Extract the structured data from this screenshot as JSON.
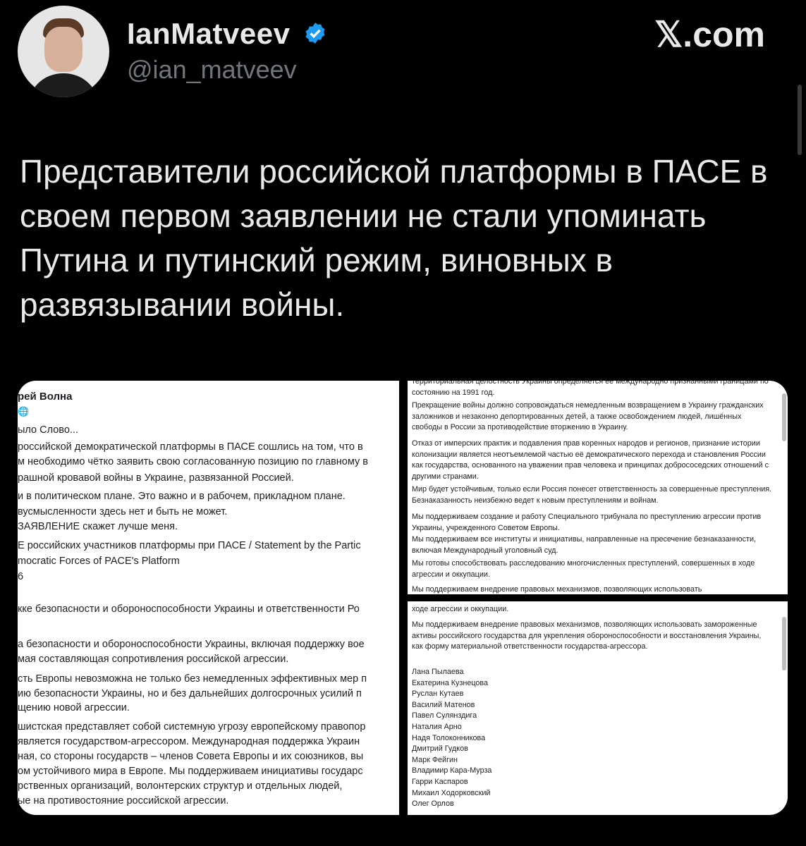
{
  "author": {
    "name": "IanMatveev",
    "handle": "@ian_matveev",
    "verified": true,
    "avatar_icon": "avatar-photo"
  },
  "brand": "𝕏.com",
  "tweet_text": "Представители российской платформы в ПАСЕ в своем первом заявлении не стали упоминать Путина и путинский режим, виновных в развязывании войны.",
  "colors": {
    "background": "#000000",
    "text": "#e7e9ea",
    "muted": "#71767b",
    "verified": "#1d9bf0"
  },
  "media": {
    "left": {
      "author": "рей Волна",
      "lines": [
        "ыло Слово...",
        "российской демократической платформы в ПАСЕ сошлись на том, что в",
        "м необходимо чётко заявить свою согласованную позицию по главному в",
        "рашной кровавой войны в Украине, развязанной Россией.",
        " и в политическом плане. Это важно и в рабочем, прикладном плане.",
        "вусмысленности здесь нет и быть не может.",
        "ЗАЯВЛЕНИЕ скажет лучше меня.",
        "Е российских участников платформы при ПАСЕ / Statement by the Partic",
        "mocratic Forces of PACE's Platform",
        "6",
        "кке безопасности и обороноспособности Украины и ответственности Ро",
        "а безопасности и обороноспособности Украины, включая поддержку вое",
        "мая составляющая сопротивления российской агрессии.",
        "сть Европы невозможна не только без немедленных эффективных мер п",
        "ию безопасности Украины, но и без дальнейших долгосрочных усилий п",
        "щению новой агрессии.",
        "шистская представляет собой системную угрозу европейскому правопор",
        "является государством-агрессором. Международная поддержка Украин",
        "ная, со стороны государств – членов Совета Европы и их союзников, вы",
        "ом устойчивого мира в Европе. Мы поддерживаем инициативы государс",
        "рственных организаций, волонтерских структур и отдельных людей,",
        "ые на противостояние российской агрессии."
      ]
    },
    "right_top": {
      "paras": [
        "территориальная целостность Украины определяется ее международно признанными границами по состоянию на 1991 год.",
        "Прекращение войны должно сопровождаться немедленным возвращением в Украину гражданских заложников и незаконно депортированных детей, а также освобождением людей, лишённых свободы в России за противодействие вторжению в Украину.",
        "Отказ от имперских практик и подавления прав коренных народов и регионов, признание истории колонизации является неотъемлемой частью её демократического перехода и становления России как государства, основанного на уважении прав человека и принципах добрососедских отношений с другими странами.",
        "Мир будет устойчивым, только если Россия понесет ответственность за совершенные преступления. Безнаказанность неизбежно ведет к новым преступлениям и войнам.",
        "Мы поддерживаем создание и работу Специального трибунала по преступлению агрессии против Украины, учрежденного Советом Европы.",
        "Мы поддерживаем все институты и инициативы, направленные на пресечение безнаказанности, включая Международный уголовный суд.",
        "Мы готовы способствовать расследованию многочисленных преступлений, совершенных в ходе агрессии и оккупации.",
        "Мы поддерживаем внедрение правовых механизмов, позволяющих использовать"
      ]
    },
    "right_bottom": {
      "paras": [
        "ходе агрессии и оккупации.",
        "Мы поддерживаем внедрение правовых механизмов, позволяющих использовать замороженные активы российского государства для укрепления обороноспособности и восстановления Украины, как форму материальной ответственности государства-агрессора."
      ],
      "signatories": [
        "Лана Пылаева",
        "Екатерина Кузнецова",
        "Руслан Кутаев",
        "Василий Матенов",
        "Павел Сулянздига",
        "Наталия Арно",
        "Надя Толоконникова",
        "Дмитрий Гудков",
        "Марк Фейгин",
        "Владимир Кара-Мурза",
        "Гарри Каспаров",
        "Михаил Ходорковский",
        "Олег Орлов"
      ]
    }
  }
}
